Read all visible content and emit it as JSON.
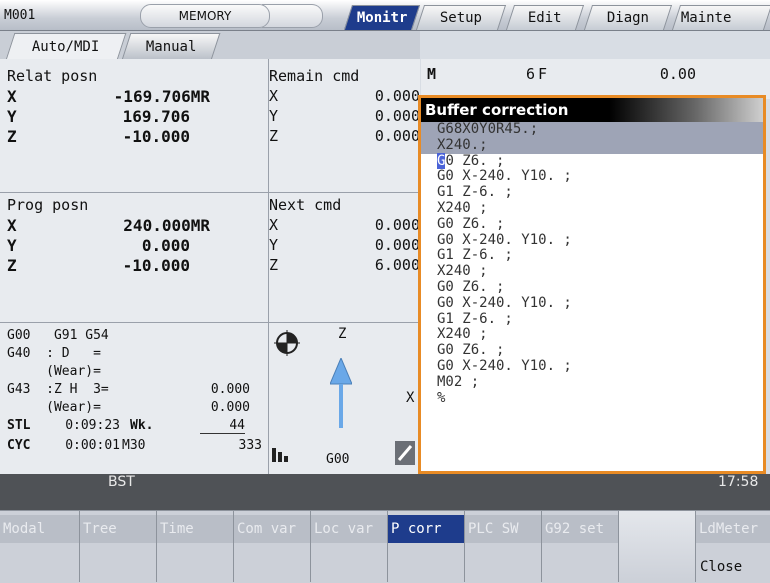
{
  "header": {
    "screen_id": "M001",
    "mode": "MEMORY",
    "tabs": [
      "Monitr",
      "Setup",
      "Edit",
      "Diagn",
      "Mainte"
    ],
    "active_tab": "Monitr"
  },
  "subtabs": [
    "Auto/MDI",
    "Manual"
  ],
  "relat_posn": {
    "title": "Relat posn",
    "axes": [
      {
        "axis": "X",
        "value": "-169.706MR"
      },
      {
        "axis": "Y",
        "value": "169.706"
      },
      {
        "axis": "Z",
        "value": "-10.000"
      }
    ]
  },
  "remain_cmd": {
    "title": "Remain cmd",
    "axes": [
      {
        "axis": "X",
        "value": "0.000"
      },
      {
        "axis": "Y",
        "value": "0.000"
      },
      {
        "axis": "Z",
        "value": "0.000"
      }
    ]
  },
  "prog_posn": {
    "title": "Prog posn",
    "axes": [
      {
        "axis": "X",
        "value": "240.000MR"
      },
      {
        "axis": "Y",
        "value": "0.000"
      },
      {
        "axis": "Z",
        "value": "-10.000"
      }
    ]
  },
  "next_cmd": {
    "title": "Next cmd",
    "axes": [
      {
        "axis": "X",
        "value": "0.000"
      },
      {
        "axis": "Y",
        "value": "0.000"
      },
      {
        "axis": "Z",
        "value": "6.000"
      }
    ]
  },
  "mf": {
    "m_label": "M",
    "m_value": "6",
    "f_label": "F",
    "f_value": "0.00"
  },
  "modal": {
    "line1": "G00   G91 G54",
    "line2a": "G40  : D   =",
    "line2b": "     (Wear)=",
    "line3a": "G43  :Z H  3=",
    "line3a_val": "0.000",
    "line3b": "     (Wear)=",
    "line3b_val": "0.000",
    "stl_label": "STL",
    "stl_time": "0:09:23",
    "wk_label": "Wk.",
    "wk_value": "44",
    "cyc_label": "CYC",
    "cyc_time": "0:00:01",
    "m30_label": "M30",
    "m30_value": "333",
    "g_code": "G00",
    "axis_z": "Z",
    "axis_x": "X"
  },
  "buffer": {
    "title": "Buffer correction",
    "lines": [
      "G68X0Y0R45.;",
      "X240.;",
      "G0 Z6. ;",
      "G0 X-240. Y10. ;",
      "G1 Z-6. ;",
      "X240 ;",
      "G0 Z6. ;",
      "G0 X-240. Y10. ;",
      "G1 Z-6. ;",
      "X240 ;",
      "G0 Z6. ;",
      "G0 X-240. Y10. ;",
      "G1 Z-6. ;",
      "X240 ;",
      "G0 Z6. ;",
      "G0 X-240. Y10. ;",
      "M02 ;",
      "%"
    ]
  },
  "status": {
    "state": "BST",
    "clock": "17:58"
  },
  "softkeys": [
    {
      "label": "Modal",
      "state": "disabled"
    },
    {
      "label": "Tree",
      "state": "disabled"
    },
    {
      "label": "Time",
      "state": "disabled"
    },
    {
      "label": "Com var",
      "state": "disabled"
    },
    {
      "label": "Loc var",
      "state": "disabled"
    },
    {
      "label": "P corr",
      "state": "active"
    },
    {
      "label": "PLC SW",
      "state": "disabled"
    },
    {
      "label": "G92 set",
      "state": "disabled"
    },
    {
      "label": "",
      "state": "blank"
    },
    {
      "label": "LdMeter",
      "state": "disabled",
      "sublabel": "Close"
    }
  ],
  "colors": {
    "accent": "#1e3c8c",
    "popup_border": "#e88b25"
  }
}
